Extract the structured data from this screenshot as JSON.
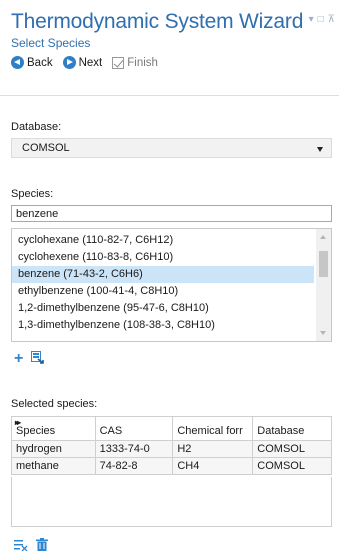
{
  "wizard": {
    "title": "Thermodynamic System Wizard",
    "subtitle": "Select Species",
    "toolbar": {
      "back_label": "Back",
      "next_label": "Next",
      "finish_label": "Finish"
    }
  },
  "database": {
    "label": "Database:",
    "value": "COMSOL"
  },
  "species": {
    "label": "Species:",
    "search_value": "benzene",
    "items": [
      "cyclohexane (110-82-7, C6H12)",
      "cyclohexene (110-83-8, C6H10)",
      "benzene (71-43-2, C6H6)",
      "ethylbenzene (100-41-4, C8H10)",
      "1,2-dimethylbenzene (95-47-6, C8H10)",
      "1,3-dimethylbenzene (108-38-3, C8H10)"
    ],
    "selected_index": 2
  },
  "selected_species": {
    "label": "Selected species:",
    "columns": [
      "Species",
      "CAS",
      "Chemical forr",
      "Database"
    ],
    "rows": [
      [
        "hydrogen",
        "1333-74-0",
        "H2",
        "COMSOL"
      ],
      [
        "methane",
        "74-82-8",
        "CH4",
        "COMSOL"
      ]
    ]
  },
  "icons": {
    "add": "plus-icon",
    "add_from_list": "add-selection-icon",
    "clear_list": "clear-list-icon",
    "delete": "trash-icon"
  },
  "colors": {
    "accent": "#2f6fb0",
    "selection": "#cce4f7",
    "icon_blue": "#2e86d1"
  }
}
